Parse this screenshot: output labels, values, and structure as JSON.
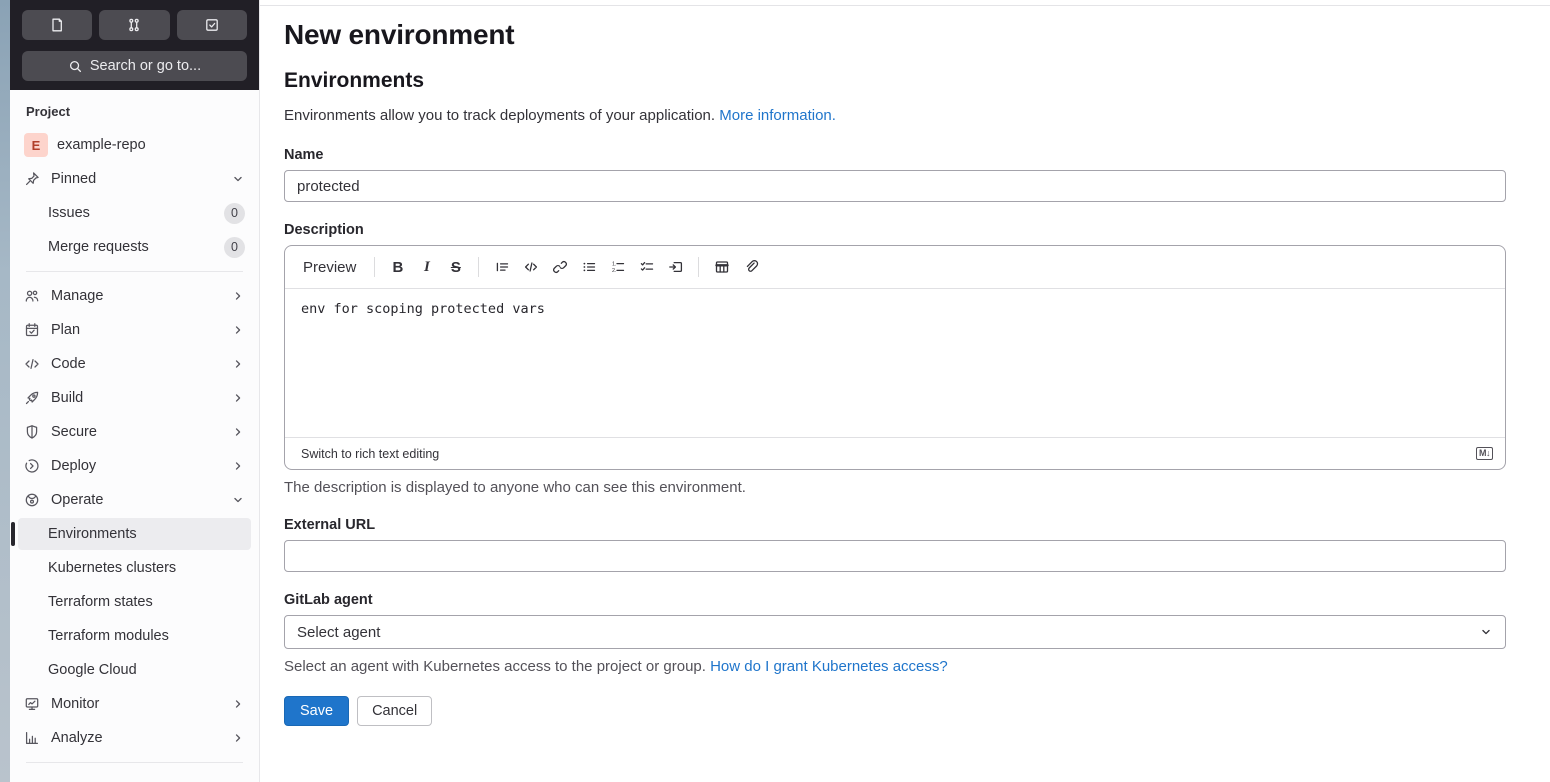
{
  "sidebar": {
    "top_buttons": [
      {
        "icon": "issues-icon"
      },
      {
        "icon": "merge-request-icon"
      },
      {
        "icon": "todo-icon"
      }
    ],
    "search": {
      "label": "Search or go to..."
    },
    "section_label": "Project",
    "project": {
      "avatar_letter": "E",
      "name": "example-repo"
    },
    "pinned": {
      "label": "Pinned"
    },
    "pinned_items": [
      {
        "label": "Issues",
        "count": "0"
      },
      {
        "label": "Merge requests",
        "count": "0"
      }
    ],
    "nav": [
      {
        "label": "Manage",
        "icon": "users-icon"
      },
      {
        "label": "Plan",
        "icon": "calendar-check-icon"
      },
      {
        "label": "Code",
        "icon": "code-icon"
      },
      {
        "label": "Build",
        "icon": "rocket-icon"
      },
      {
        "label": "Secure",
        "icon": "shield-icon"
      },
      {
        "label": "Deploy",
        "icon": "deploy-icon"
      },
      {
        "label": "Operate",
        "icon": "operate-icon"
      }
    ],
    "operate_items": [
      {
        "label": "Environments"
      },
      {
        "label": "Kubernetes clusters"
      },
      {
        "label": "Terraform states"
      },
      {
        "label": "Terraform modules"
      },
      {
        "label": "Google Cloud"
      }
    ],
    "nav_bottom": [
      {
        "label": "Monitor",
        "icon": "monitor-icon"
      },
      {
        "label": "Analyze",
        "icon": "chart-icon"
      }
    ]
  },
  "main": {
    "page_title": "New environment",
    "section_title": "Environments",
    "intro": {
      "text": "Environments allow you to track deployments of your application.",
      "link": "More information."
    },
    "name_field": {
      "label": "Name",
      "value": "protected"
    },
    "description": {
      "label": "Description",
      "toolbar": {
        "preview": "Preview",
        "bold_glyph": "B",
        "italic_glyph": "I",
        "strike_glyph": "S",
        "icons": [
          "quote-icon",
          "code-icon",
          "link-icon",
          "bullet-list-icon",
          "numbered-list-icon",
          "task-list-icon",
          "collapsible-section-icon",
          "table-icon",
          "attach-file-icon"
        ]
      },
      "value": "env for scoping protected vars",
      "footer_action": "Switch to rich text editing",
      "markdown_icon_label": "M↓",
      "help": "The description is displayed to anyone who can see this environment."
    },
    "external_url_field": {
      "label": "External URL",
      "value": ""
    },
    "gitlab_agent_field": {
      "label": "GitLab agent",
      "selected": "Select agent",
      "help": "Select an agent with Kubernetes access to the project or group.",
      "help_link": "How do I grant Kubernetes access?"
    },
    "actions": {
      "save": "Save",
      "cancel": "Cancel"
    }
  },
  "colors": {
    "accent_blue": "#1f75cb",
    "link_blue": "#1f75cb",
    "sidebar_header_dark": "#211f26",
    "sidebar_bg": "#fcfcfd",
    "active_item_bg": "#ececef",
    "avatar_bg": "#fdd4cc",
    "avatar_text": "#b2402a"
  }
}
